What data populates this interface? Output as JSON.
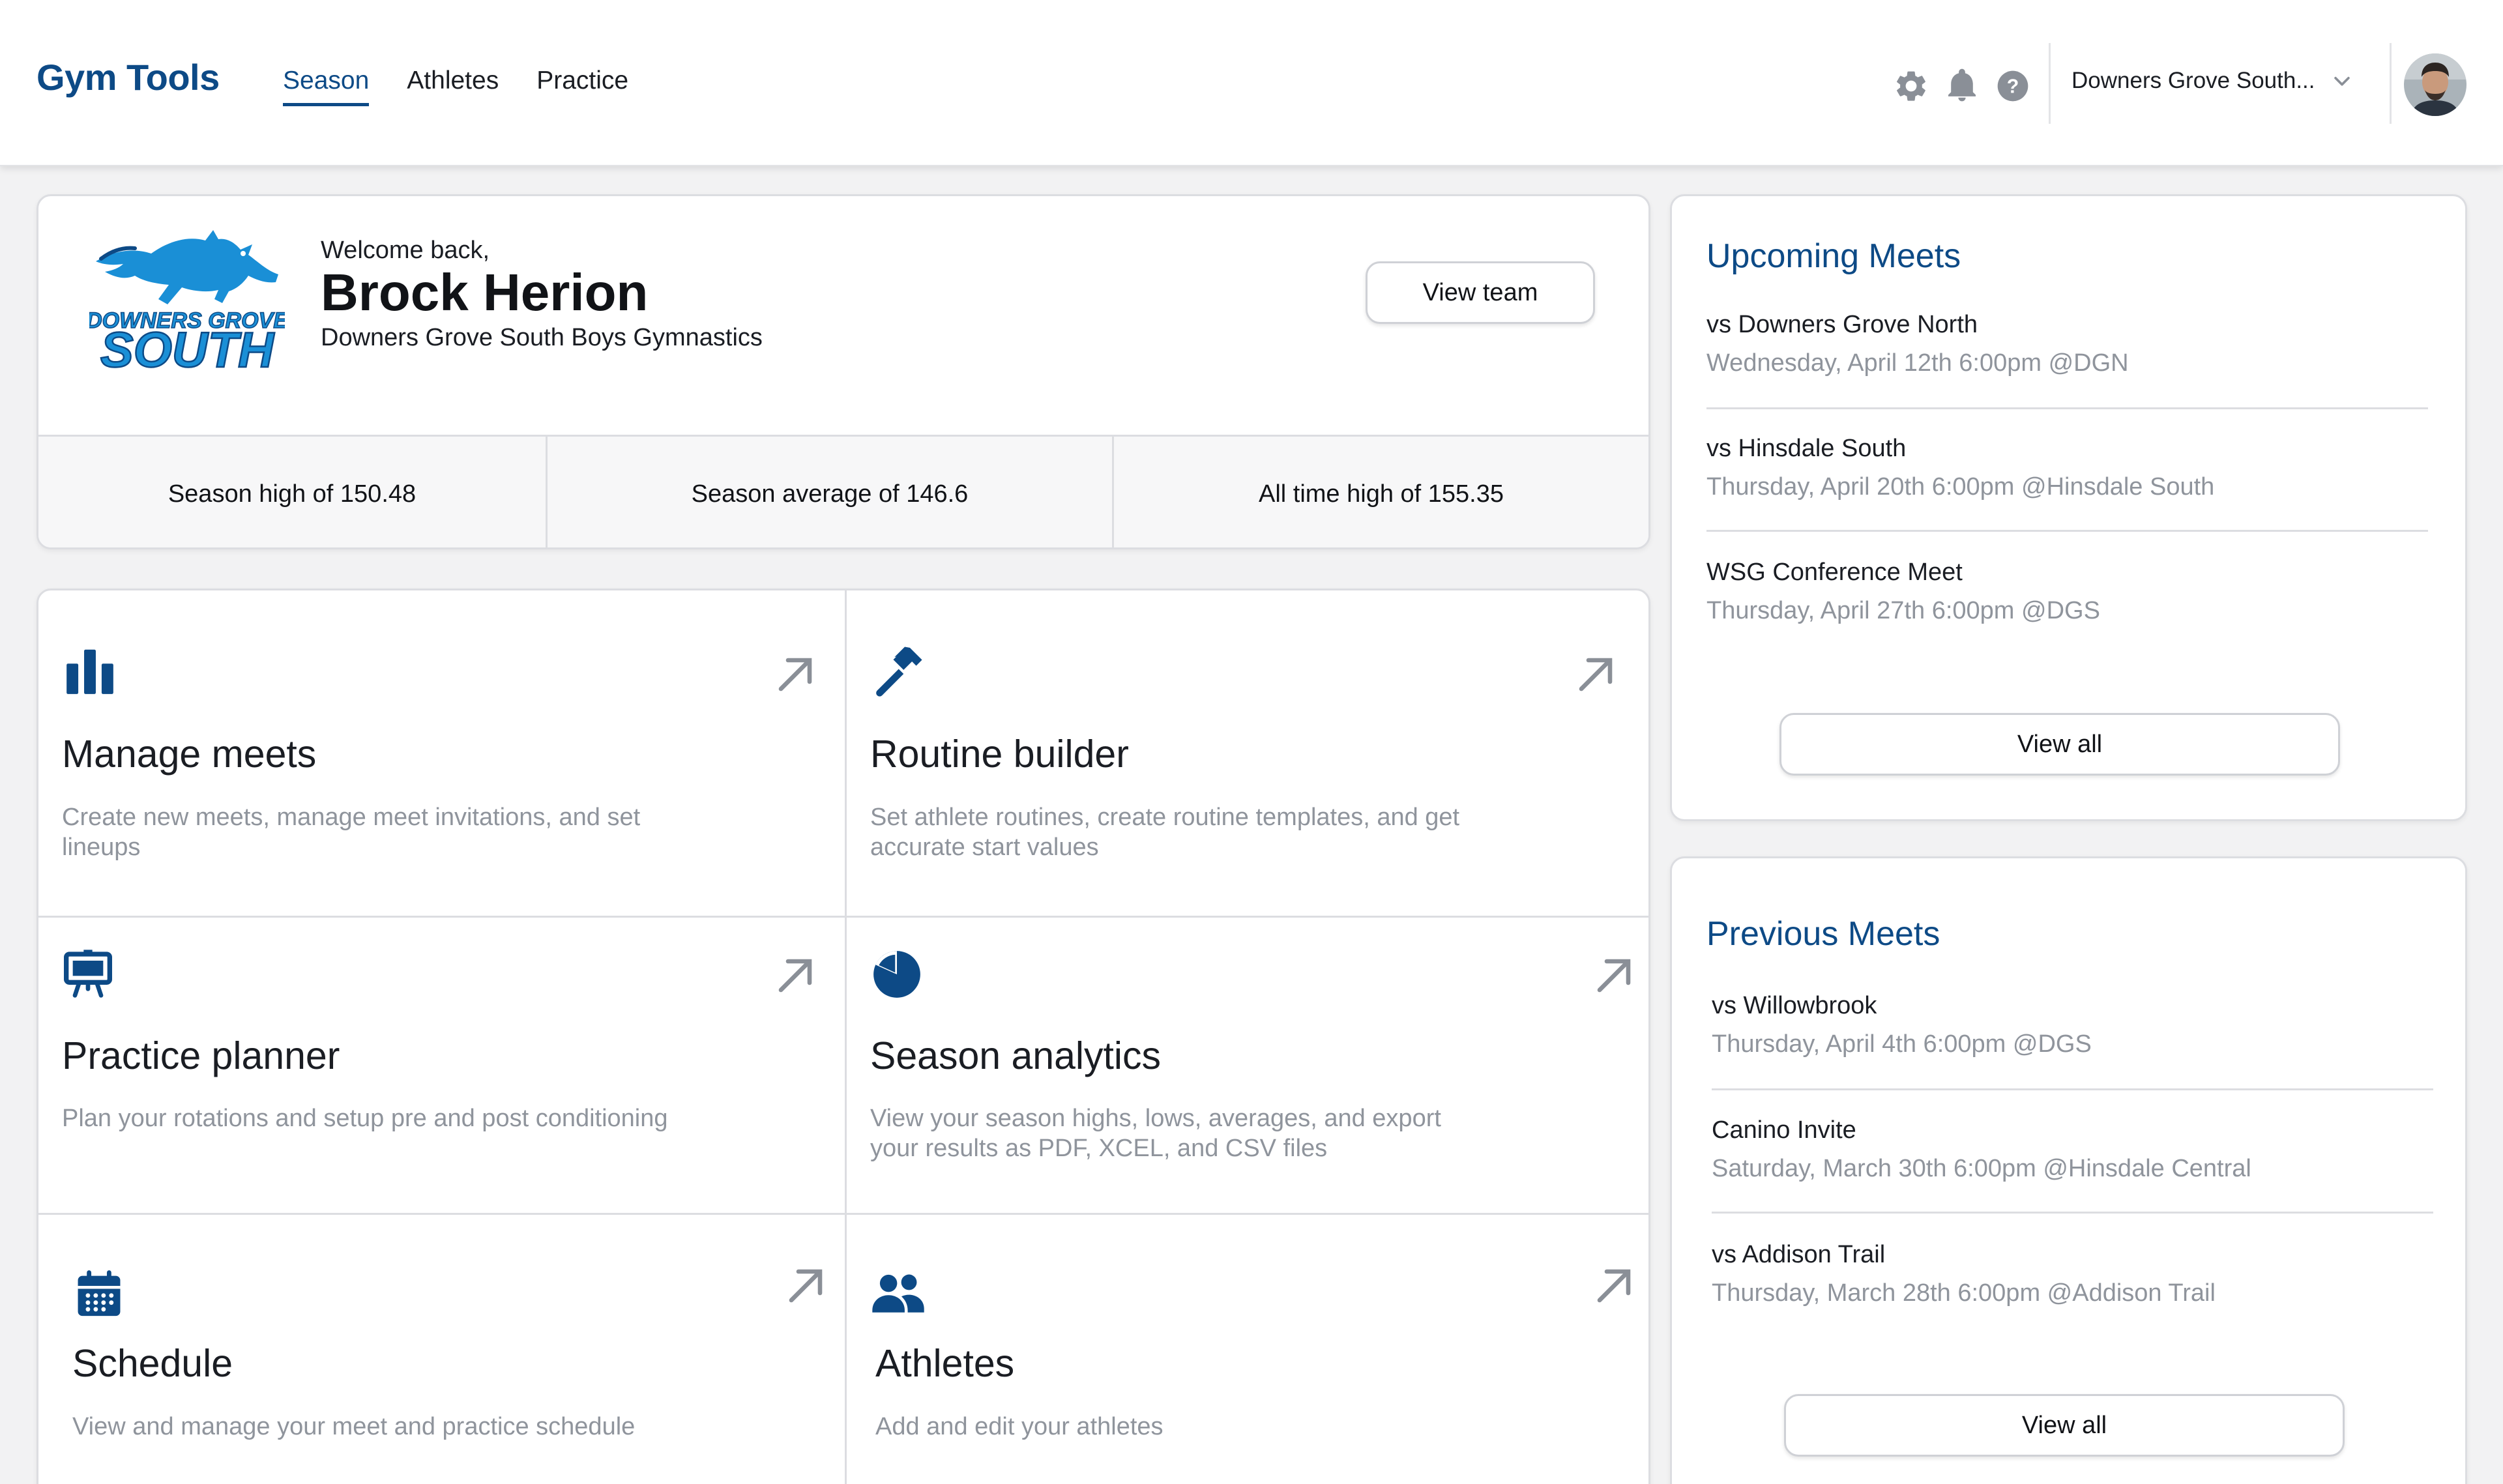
{
  "header": {
    "brand": "Gym Tools",
    "nav": [
      "Season",
      "Athletes",
      "Practice"
    ],
    "active_nav": "Season",
    "team_selector": "Downers Grove South...",
    "icons": [
      "gear-icon",
      "bell-icon",
      "help-icon",
      "chevron-down-icon"
    ]
  },
  "welcome": {
    "greeting": "Welcome back,",
    "name": "Brock Herion",
    "team": "Downers Grove South Boys Gymnastics",
    "view_team_label": "View team",
    "logo_text_top": "DOWNERS GROVE",
    "logo_text_bottom": "SOUTH"
  },
  "stats": [
    "Season high of 150.48",
    "Season average of 146.6",
    "All time high of 155.35"
  ],
  "features": [
    {
      "title": "Manage meets",
      "description": "Create new meets, manage meet invitations, and set lineups",
      "icon": "bar-chart-icon"
    },
    {
      "title": "Routine builder",
      "description": "Set athlete routines, create routine templates, and get accurate start values",
      "icon": "hammer-icon"
    },
    {
      "title": "Practice planner",
      "description": "Plan your rotations and setup pre and post conditioning",
      "icon": "easel-icon"
    },
    {
      "title": "Season analytics",
      "description": "View your season highs, lows, averages, and export your results as PDF, XCEL, and CSV files",
      "icon": "pie-chart-icon"
    },
    {
      "title": "Schedule",
      "description": "View and manage your meet and practice schedule",
      "icon": "calendar-icon"
    },
    {
      "title": "Athletes",
      "description": "Add and edit your athletes",
      "icon": "users-icon"
    }
  ],
  "upcoming": {
    "title": "Upcoming Meets",
    "meets": [
      {
        "name": "vs Downers Grove North",
        "detail": "Wednesday, April 12th 6:00pm @DGN"
      },
      {
        "name": "vs Hinsdale South",
        "detail": "Thursday, April 20th 6:00pm @Hinsdale South"
      },
      {
        "name": "WSG Conference Meet",
        "detail": "Thursday, April 27th 6:00pm @DGS"
      }
    ],
    "view_all_label": "View all"
  },
  "previous": {
    "title": "Previous Meets",
    "meets": [
      {
        "name": "vs Willowbrook",
        "detail": "Thursday, April 4th 6:00pm @DGS"
      },
      {
        "name": "Canino Invite",
        "detail": "Saturday, March 30th 6:00pm @Hinsdale Central"
      },
      {
        "name": "vs Addison Trail",
        "detail": "Thursday, March 28th 6:00pm @Addison Trail"
      }
    ],
    "view_all_label": "View all"
  },
  "colors": {
    "brand": "#0d4a86",
    "logo_blue": "#1a8fd6",
    "muted_text": "#8f949c",
    "icon_gray": "#8a8f97"
  }
}
